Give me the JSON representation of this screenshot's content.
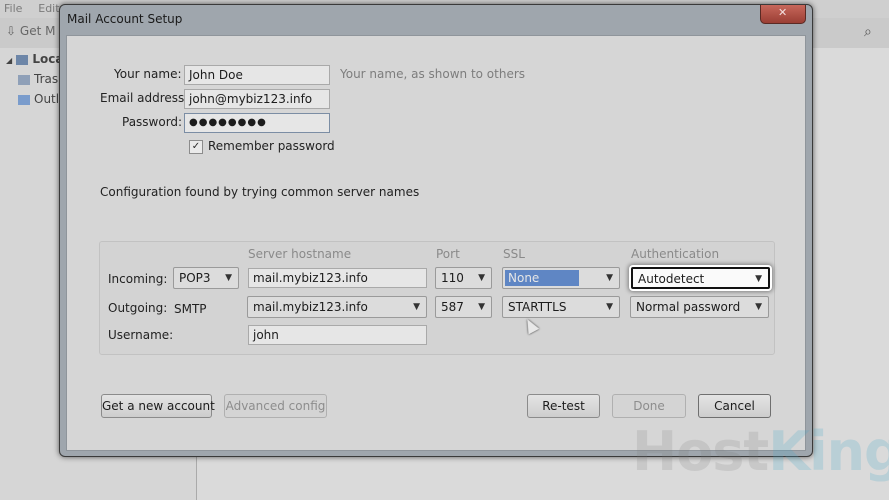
{
  "background_app": {
    "menu": [
      "File",
      "Edit"
    ],
    "toolbar_get": "Get M",
    "tree": [
      {
        "label": "Local",
        "bold": true
      },
      {
        "label": "Tras"
      },
      {
        "label": "Outl"
      }
    ]
  },
  "dialog": {
    "title": "Mail Account Setup",
    "your_name_label": "Your name:",
    "your_name_value": "John Doe",
    "your_name_hint": "Your name, as shown to others",
    "email_label": "Email address:",
    "email_value": "john@mybiz123.info",
    "password_label": "Password:",
    "password_value": "●●●●●●●●",
    "remember_label": "Remember password",
    "remember_checked": true,
    "config_message": "Configuration found by trying common server names",
    "columns": {
      "server": "Server hostname",
      "port": "Port",
      "ssl": "SSL",
      "auth": "Authentication"
    },
    "incoming": {
      "label": "Incoming:",
      "protocol": "POP3",
      "hostname": "mail.mybiz123.info",
      "port": "110",
      "ssl": "None",
      "auth": "Autodetect"
    },
    "outgoing": {
      "label": "Outgoing:",
      "protocol": "SMTP",
      "hostname": "mail.mybiz123.info",
      "port": "587",
      "ssl": "STARTTLS",
      "auth": "Normal password"
    },
    "username_label": "Username:",
    "username_value": "john",
    "buttons": {
      "new_account": "Get a new account",
      "advanced": "Advanced config",
      "retest": "Re-test",
      "done": "Done",
      "cancel": "Cancel"
    }
  },
  "watermark": {
    "host": "Host",
    "king": "King"
  },
  "colors": {
    "selection": "#5f86c4",
    "dialog_frame": "#9fa6ad",
    "close": "#b04b40"
  }
}
